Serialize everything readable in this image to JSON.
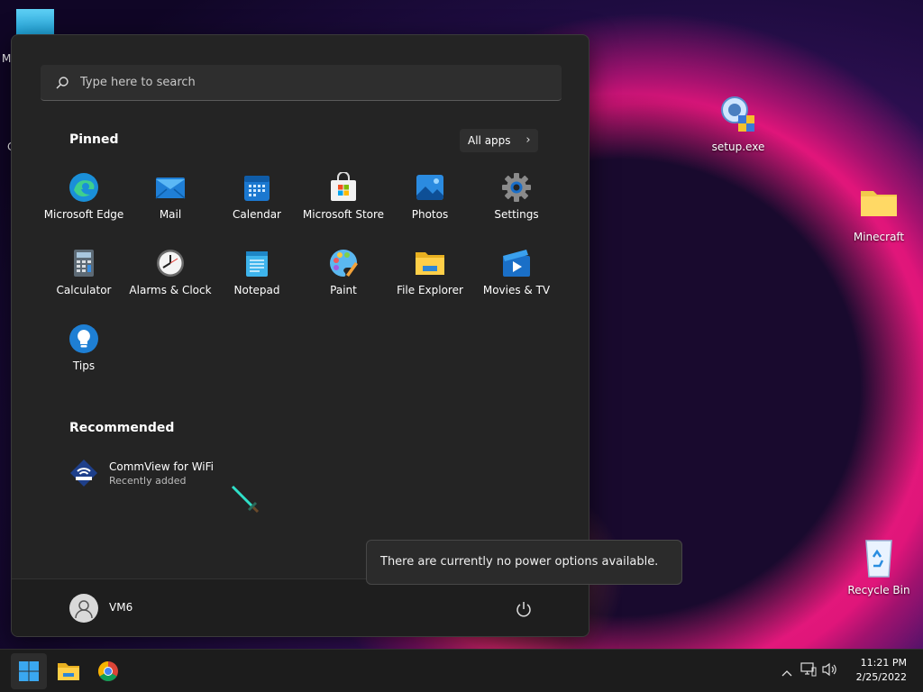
{
  "desktop": {
    "icons": [
      {
        "name": "setup.exe"
      },
      {
        "name": "Minecraft"
      },
      {
        "name": "Recycle Bin"
      }
    ],
    "partial_labels": [
      "M",
      "C"
    ]
  },
  "start_menu": {
    "search_placeholder": "Type here to search",
    "pinned_title": "Pinned",
    "all_apps_label": "All apps",
    "pinned_apps": [
      {
        "label": "Microsoft Edge",
        "icon": "edge-icon"
      },
      {
        "label": "Mail",
        "icon": "mail-icon"
      },
      {
        "label": "Calendar",
        "icon": "calendar-icon"
      },
      {
        "label": "Microsoft Store",
        "icon": "store-icon"
      },
      {
        "label": "Photos",
        "icon": "photos-icon"
      },
      {
        "label": "Settings",
        "icon": "gear-icon"
      },
      {
        "label": "Calculator",
        "icon": "calculator-icon"
      },
      {
        "label": "Alarms & Clock",
        "icon": "clock-icon"
      },
      {
        "label": "Notepad",
        "icon": "notepad-icon"
      },
      {
        "label": "Paint",
        "icon": "palette-icon"
      },
      {
        "label": "File Explorer",
        "icon": "folder-icon"
      },
      {
        "label": "Movies & TV",
        "icon": "movies-icon"
      },
      {
        "label": "Tips",
        "icon": "lightbulb-icon"
      }
    ],
    "recommended_title": "Recommended",
    "recommended": [
      {
        "title": "CommView for WiFi",
        "subtitle": "Recently added"
      }
    ],
    "user_name": "VM6",
    "power_tooltip": "There are currently no power options available."
  },
  "taskbar": {
    "time": "11:21 PM",
    "date": "2/25/2022"
  },
  "colors": {
    "menu_bg": "#242424",
    "accent_blue": "#0078d4",
    "taskbar_bg": "#1c1c1c"
  }
}
